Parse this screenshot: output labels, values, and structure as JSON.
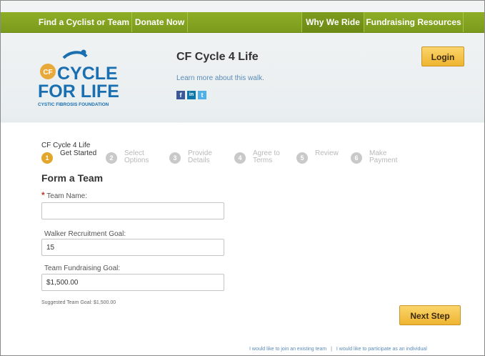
{
  "nav": {
    "items": [
      {
        "label": "Find a Cyclist or Team"
      },
      {
        "label": "Donate Now"
      },
      {
        "label": "Why We Ride"
      },
      {
        "label": "Fundraising Resources"
      }
    ]
  },
  "header": {
    "logo_line1": "CYCLE",
    "logo_cf": "CF",
    "logo_line2": "FOR LIFE",
    "logo_org": "CYSTIC FIBROSIS FOUNDATION",
    "walk_title": "CF Cycle 4 Life",
    "learn_more": "Learn more about this walk.",
    "login_label": "Login",
    "social": [
      "f",
      "in",
      "t"
    ]
  },
  "breadcrumb": "CF Cycle 4 Life",
  "steps": [
    {
      "num": "1",
      "label": "Get Started",
      "active": true
    },
    {
      "num": "2",
      "label": "Select Options",
      "active": false
    },
    {
      "num": "3",
      "label": "Provide Details",
      "active": false
    },
    {
      "num": "4",
      "label": "Agree to Terms",
      "active": false
    },
    {
      "num": "5",
      "label": "Review",
      "active": false
    },
    {
      "num": "6",
      "label": "Make Payment",
      "active": false
    }
  ],
  "form": {
    "title": "Form a Team",
    "team_name_label": "Team Name:",
    "team_name_value": "",
    "walker_goal_label": "Walker Recruitment Goal:",
    "walker_goal_value": "15",
    "fundraising_goal_label": "Team Fundraising Goal:",
    "fundraising_goal_value": "$1,500.00",
    "suggested": "Suggested Team Goal: $1,500.00",
    "next_label": "Next Step"
  },
  "footer": {
    "join_link": "I would like to join an existing team",
    "individual_link": "I would like to participate as an individual",
    "separator": "|"
  },
  "colors": {
    "nav_green": "#8fae26",
    "button_gold": "#eeb430",
    "logo_blue": "#1a6fb0",
    "logo_orange": "#e8a93a"
  }
}
